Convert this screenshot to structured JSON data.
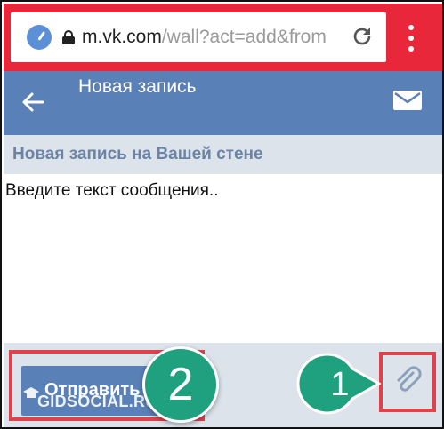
{
  "browser": {
    "url_host": "m.vk.com",
    "url_path": "/wall?act=add&from",
    "bar_color": "#e8283a"
  },
  "header": {
    "title": "Новая запись",
    "color": "#5a80b8"
  },
  "section": {
    "title": "Новая запись на Вашей стене"
  },
  "composer": {
    "placeholder": "Введите текст сообщения.."
  },
  "actions": {
    "send_label": "Отправить",
    "attach_icon": "paperclip-icon"
  },
  "watermark": {
    "text": "GIDSOCIAL.RU"
  },
  "annotations": {
    "step_1": "1",
    "step_2": "2",
    "highlight_color": "#e0424c",
    "badge_color": "#1fa07e"
  }
}
